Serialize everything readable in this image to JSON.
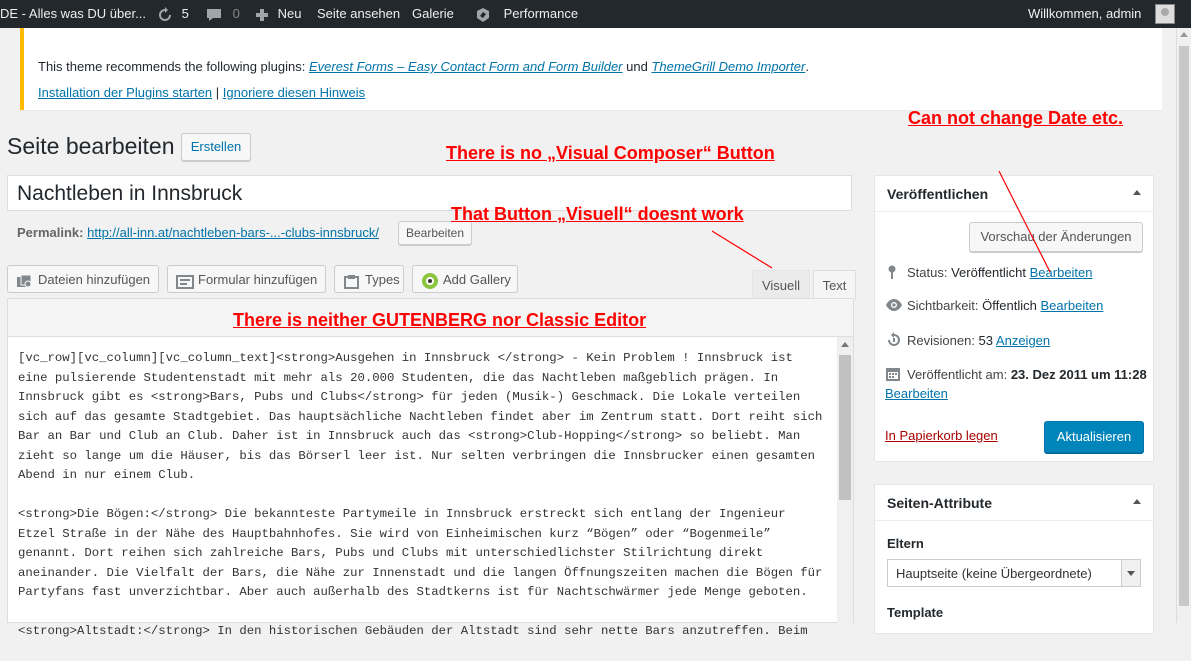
{
  "adminbar": {
    "site_title": "DE - Alles was DU über...",
    "updates_count": "5",
    "comments_count": "0",
    "new_label": "Neu",
    "view_page": "Seite ansehen",
    "gallery": "Galerie",
    "performance": "Performance",
    "welcome": "Willkommen, admin"
  },
  "notice": {
    "text_before": "This theme recommends the following plugins: ",
    "plugin1": "Everest Forms – Easy Contact Form and Form Builder",
    "and": " und ",
    "plugin2": "ThemeGrill Demo Importer",
    "period": ".",
    "install_link": "Installation der Plugins starten",
    "separator": " | ",
    "dismiss_link": "Ignoriere diesen Hinweis"
  },
  "page": {
    "heading": "Seite bearbeiten",
    "create_button": "Erstellen",
    "title_value": "Nachtleben in Innsbruck",
    "permalink_label": "Permalink:",
    "permalink_url": "http://all-inn.at/nachtleben-bars-...-clubs-innsbruck/",
    "permalink_edit": "Bearbeiten"
  },
  "media_buttons": {
    "add_files": "Dateien hinzufügen",
    "add_form": "Formular hinzufügen",
    "types": "Types",
    "add_gallery": "Add Gallery"
  },
  "editor": {
    "tab_visual": "Visuell",
    "tab_text": "Text",
    "paragraphs": [
      "[vc_row][vc_column][vc_column_text]<strong>Ausgehen in Innsbruck </strong> - Kein Problem ! Innsbruck ist eine pulsierende Studentenstadt mit mehr als 20.000 Studenten, die das Nachtleben maßgeblich prägen. In Innsbruck  gibt es <strong>Bars, Pubs und Clubs</strong> für jeden (Musik-) Geschmack. Die Lokale verteilen sich auf das gesamte Stadtgebiet. Das hauptsächliche Nachtleben findet aber im Zentrum statt. Dort reiht sich Bar an Bar und Club an Club. Daher ist in Innsbruck auch das <strong>Club-Hopping</strong> so beliebt. Man zieht so lange um die Häuser, bis das Börserl leer ist. Nur selten verbringen die Innsbrucker einen gesamten Abend in nur einem Club.",
      "<strong>Die Bögen:</strong> Die bekannteste Partymeile in Innsbruck erstreckt  sich entlang der Ingenieur Etzel Straße in der Nähe des Hauptbahnhofes. Sie wird von Einheimischen kurz “Bögen” oder “Bogenmeile” genannt. Dort reihen sich zahlreiche Bars, Pubs und Clubs mit unterschiedlichster Stilrichtung direkt aneinander. Die Vielfalt der Bars, die Nähe zur Innenstadt und die langen Öffnungszeiten machen die Bögen  für Partyfans fast unverzichtbar. Aber auch außerhalb des Stadtkerns ist für Nachtschwärmer jede Menge geboten.",
      "<strong>Altstadt:</strong> In den historischen Gebäuden der Altstadt sind sehr nette Bars anzutreffen. Beim"
    ]
  },
  "publish_box": {
    "title": "Veröffentlichen",
    "preview_button": "Vorschau der Änderungen",
    "status_label": "Status: ",
    "status_value": "Veröffentlicht",
    "status_edit": "Bearbeiten",
    "visibility_label": "Sichtbarkeit: ",
    "visibility_value": "Öffentlich",
    "visibility_edit": "Bearbeiten",
    "revisions_label": "Revisionen: ",
    "revisions_value": "53",
    "revisions_link": "Anzeigen",
    "published_label": "Veröffentlicht am: ",
    "published_value": "23. Dez 2011 um 11:28",
    "published_edit": "Bearbeiten",
    "trash_link": "In Papierkorb legen",
    "update_button": "Aktualisieren"
  },
  "attributes_box": {
    "title": "Seiten-Attribute",
    "parent_label": "Eltern",
    "parent_select": "Hauptseite (keine Übergeordnete)",
    "template_label": "Template"
  },
  "annotations": {
    "date": "Can not change Date etc.",
    "visual_composer": "There is no „Visual Composer“ Button",
    "visuell": "That Button „Visuell“ doesnt work",
    "editor": "There is neither GUTENBERG nor Classic Editor"
  },
  "colors": {
    "annotation": "#ff0000",
    "link": "#0073aa",
    "primary_button": "#0085ba",
    "notice_border": "#ffb900",
    "adminbar": "#23282d"
  }
}
